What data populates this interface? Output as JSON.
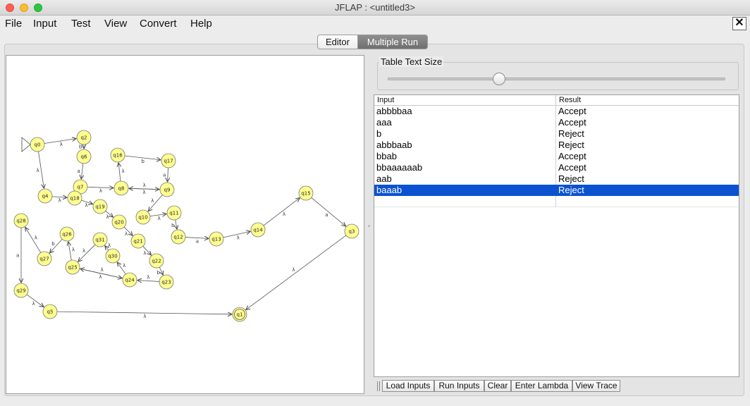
{
  "window": {
    "title": "JFLAP : <untitled3>",
    "close_label": "✕"
  },
  "menu": [
    "File",
    "Input",
    "Test",
    "View",
    "Convert",
    "Help"
  ],
  "tabs": [
    {
      "label": "Editor",
      "active": false
    },
    {
      "label": "Multiple Run",
      "active": true
    }
  ],
  "panel": {
    "table_text_size_label": "Table Text Size",
    "slider_value_fraction": 0.33
  },
  "table": {
    "columns": [
      "Input",
      "Result"
    ],
    "rows": [
      {
        "input": "abbbbaa",
        "result": "Accept",
        "selected": false
      },
      {
        "input": "aaa",
        "result": "Accept",
        "selected": false
      },
      {
        "input": "b",
        "result": "Reject",
        "selected": false
      },
      {
        "input": "abbbaab",
        "result": "Reject",
        "selected": false
      },
      {
        "input": "bbab",
        "result": "Accept",
        "selected": false
      },
      {
        "input": "bbaaaaaab",
        "result": "Accept",
        "selected": false
      },
      {
        "input": "aab",
        "result": "Reject",
        "selected": false
      },
      {
        "input": "baaab",
        "result": "Reject",
        "selected": true
      }
    ]
  },
  "buttons": [
    "Load Inputs",
    "Run Inputs",
    "Clear",
    "Enter Lambda",
    "View Trace"
  ],
  "automaton": {
    "initial_state": "q0",
    "final_states": [
      "q1"
    ],
    "states": [
      "q0",
      "q1",
      "q2",
      "q3",
      "q4",
      "q5",
      "q6",
      "q7",
      "q8",
      "q9",
      "q10",
      "q11",
      "q12",
      "q13",
      "q14",
      "q15",
      "q16",
      "q17",
      "q18",
      "q19",
      "q20",
      "q21",
      "q22",
      "q23",
      "q24",
      "q25",
      "q26",
      "q27",
      "q28",
      "q29",
      "q30",
      "q31"
    ],
    "transitions": [
      {
        "from": "q0",
        "to": "q2",
        "label": "λ"
      },
      {
        "from": "q0",
        "to": "q4",
        "label": "λ"
      },
      {
        "from": "q2",
        "to": "q6",
        "label": "b"
      },
      {
        "from": "q6",
        "to": "q7",
        "label": "a"
      },
      {
        "from": "q7",
        "to": "q8",
        "label": "λ"
      },
      {
        "from": "q7",
        "to": "q18",
        "label": "λ"
      },
      {
        "from": "q8",
        "to": "q16",
        "label": "λ"
      },
      {
        "from": "q16",
        "to": "q17",
        "label": "b"
      },
      {
        "from": "q17",
        "to": "q9",
        "label": "a"
      },
      {
        "from": "q8",
        "to": "q9",
        "label": "λ"
      },
      {
        "from": "q9",
        "to": "q8",
        "label": "λ"
      },
      {
        "from": "q9",
        "to": "q10",
        "label": "λ"
      },
      {
        "from": "q10",
        "to": "q11",
        "label": "λ"
      },
      {
        "from": "q11",
        "to": "q12",
        "label": "b"
      },
      {
        "from": "q12",
        "to": "q13",
        "label": "a"
      },
      {
        "from": "q13",
        "to": "q14",
        "label": "λ"
      },
      {
        "from": "q14",
        "to": "q15",
        "label": "λ"
      },
      {
        "from": "q15",
        "to": "q3",
        "label": "a"
      },
      {
        "from": "q3",
        "to": "q1",
        "label": "λ"
      },
      {
        "from": "q4",
        "to": "q18",
        "label": "λ"
      },
      {
        "from": "q18",
        "to": "q19",
        "label": "λ"
      },
      {
        "from": "q19",
        "to": "q20",
        "label": "λ"
      },
      {
        "from": "q20",
        "to": "q21",
        "label": "λ"
      },
      {
        "from": "q21",
        "to": "q22",
        "label": "λ"
      },
      {
        "from": "q22",
        "to": "q23",
        "label": "b"
      },
      {
        "from": "q23",
        "to": "q24",
        "label": "λ"
      },
      {
        "from": "q24",
        "to": "q30",
        "label": "λ"
      },
      {
        "from": "q30",
        "to": "q31",
        "label": "λ"
      },
      {
        "from": "q31",
        "to": "q25",
        "label": "λ"
      },
      {
        "from": "q24",
        "to": "q25",
        "label": "λ"
      },
      {
        "from": "q25",
        "to": "q24",
        "label": "λ"
      },
      {
        "from": "q25",
        "to": "q26",
        "label": "λ"
      },
      {
        "from": "q26",
        "to": "q27",
        "label": "b"
      },
      {
        "from": "q27",
        "to": "q28",
        "label": "λ"
      },
      {
        "from": "q28",
        "to": "q29",
        "label": "a"
      },
      {
        "from": "q29",
        "to": "q5",
        "label": "λ"
      },
      {
        "from": "q5",
        "to": "q1",
        "label": "λ"
      }
    ]
  }
}
